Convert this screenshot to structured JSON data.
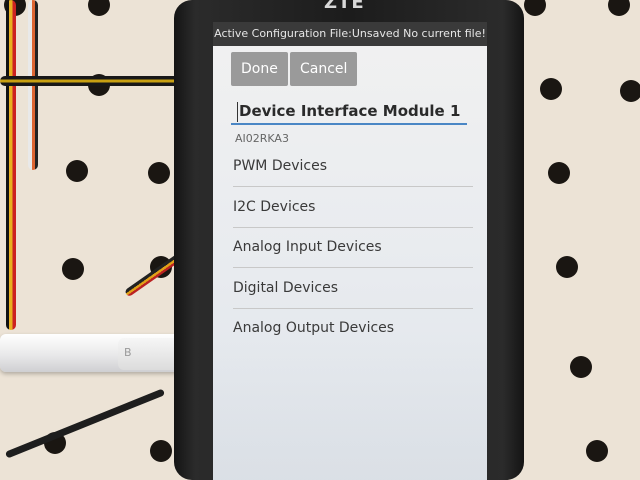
{
  "device": {
    "brand": "ZTE"
  },
  "status_bar": {
    "text": "Active Configuration File:Unsaved No current file!"
  },
  "toolbar": {
    "done_label": "Done",
    "cancel_label": "Cancel"
  },
  "module": {
    "name": "Device Interface Module 1",
    "serial": "AI02RKA3"
  },
  "menu": [
    {
      "label": "PWM Devices"
    },
    {
      "label": "I2C Devices"
    },
    {
      "label": "Analog Input Devices"
    },
    {
      "label": "Digital Devices"
    },
    {
      "label": "Analog Output Devices"
    }
  ],
  "cable": {
    "mark": "B"
  },
  "colors": {
    "accent": "#4a86c5",
    "button": "#9a9a9a",
    "status_bar": "#3a3a3a"
  }
}
